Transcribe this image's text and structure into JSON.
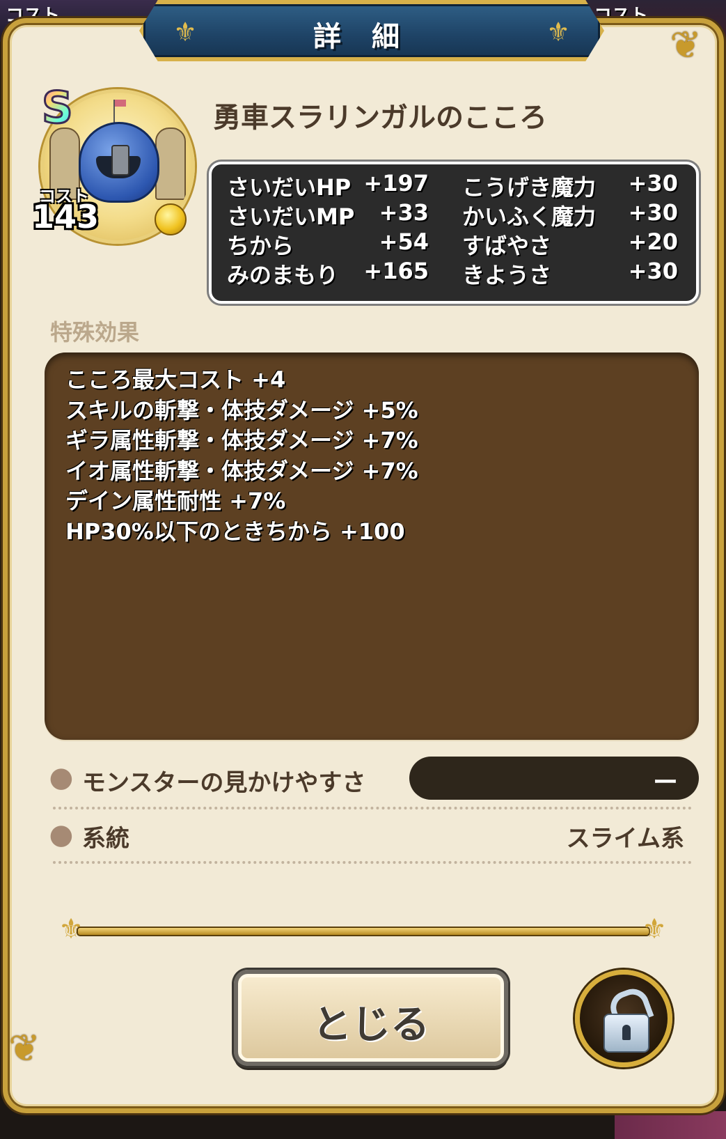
{
  "background": {
    "left_cost_label": "コスト",
    "right_cost_label": "コスト"
  },
  "dialog": {
    "title": "詳細"
  },
  "monster": {
    "rank": "S",
    "cost_label": "コスト",
    "cost_value": "143",
    "name": "勇車スラリンガルのこころ"
  },
  "stats": [
    {
      "label": "さいだいHP",
      "value": "+197"
    },
    {
      "label": "さいだいMP",
      "value": "+33"
    },
    {
      "label": "ちから",
      "value": "+54"
    },
    {
      "label": "みのまもり",
      "value": "+165"
    },
    {
      "label": "こうげき魔力",
      "value": "+30"
    },
    {
      "label": "かいふく魔力",
      "value": "+30"
    },
    {
      "label": "すばやさ",
      "value": "+20"
    },
    {
      "label": "きようさ",
      "value": "+30"
    }
  ],
  "special": {
    "label": "特殊効果",
    "effects": [
      "こころ最大コスト +4",
      "スキルの斬撃・体技ダメージ +5%",
      "ギラ属性斬撃・体技ダメージ +7%",
      "イオ属性斬撃・体技ダメージ +7%",
      "デイン属性耐性 +7%",
      "HP30%以下のときちから +100"
    ]
  },
  "info": {
    "visibility_label": "モンスターの見かけやすさ",
    "visibility_value": "ー",
    "type_label": "系統",
    "type_value": "スライム系"
  },
  "buttons": {
    "close_label": "とじる"
  },
  "icons": {
    "row_bullet": "slime-drop-icon",
    "lock": "unlocked-padlock-icon"
  },
  "colors": {
    "panel_bg": "#f2ead6",
    "gold_border": "#c8a13c",
    "title_blue": "#1e4366",
    "effects_bg": "#5d4022",
    "stats_bg": "#2b2b2b"
  }
}
